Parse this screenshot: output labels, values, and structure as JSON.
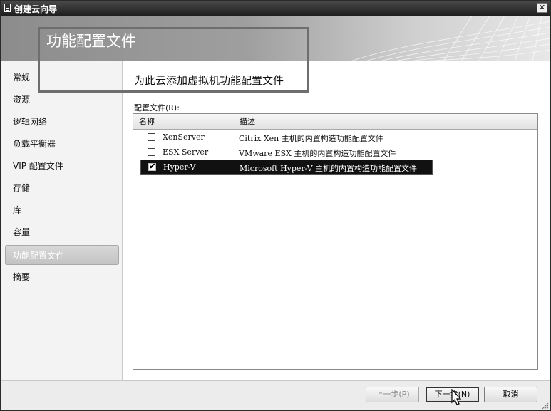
{
  "window": {
    "title": "创建云向导",
    "close_glyph": "✕"
  },
  "banner": {
    "title": "功能配置文件"
  },
  "sidebar": {
    "items": [
      {
        "label": "常规",
        "active": false
      },
      {
        "label": "资源",
        "active": false
      },
      {
        "label": "逻辑网络",
        "active": false
      },
      {
        "label": "负载平衡器",
        "active": false
      },
      {
        "label": "VIP 配置文件",
        "active": false
      },
      {
        "label": "存储",
        "active": false
      },
      {
        "label": "库",
        "active": false
      },
      {
        "label": "容量",
        "active": false
      },
      {
        "label": "功能配置文件",
        "active": true
      },
      {
        "label": "摘要",
        "active": false
      }
    ]
  },
  "main": {
    "heading": "为此云添加虚拟机功能配置文件",
    "list_label": "配置文件(R):",
    "columns": {
      "name": "名称",
      "description": "描述"
    },
    "rows": [
      {
        "name": "XenServer",
        "description": "Citrix Xen 主机的内置构造功能配置文件",
        "checked": false,
        "selected": false
      },
      {
        "name": "ESX Server",
        "description": "VMware ESX 主机的内置构造功能配置文件",
        "checked": false,
        "selected": false
      },
      {
        "name": "Hyper-V",
        "description": "Microsoft Hyper-V 主机的内置构造功能配置文件",
        "checked": true,
        "selected": true
      }
    ]
  },
  "footer": {
    "previous_label": "上一步(P)",
    "next_label": "下一步(N)",
    "cancel_label": "取消"
  },
  "icons": {
    "checkmark": "✔",
    "app": "window-icon",
    "resize": "resize-grip-icon",
    "pointer": "mouse-pointer-icon"
  }
}
